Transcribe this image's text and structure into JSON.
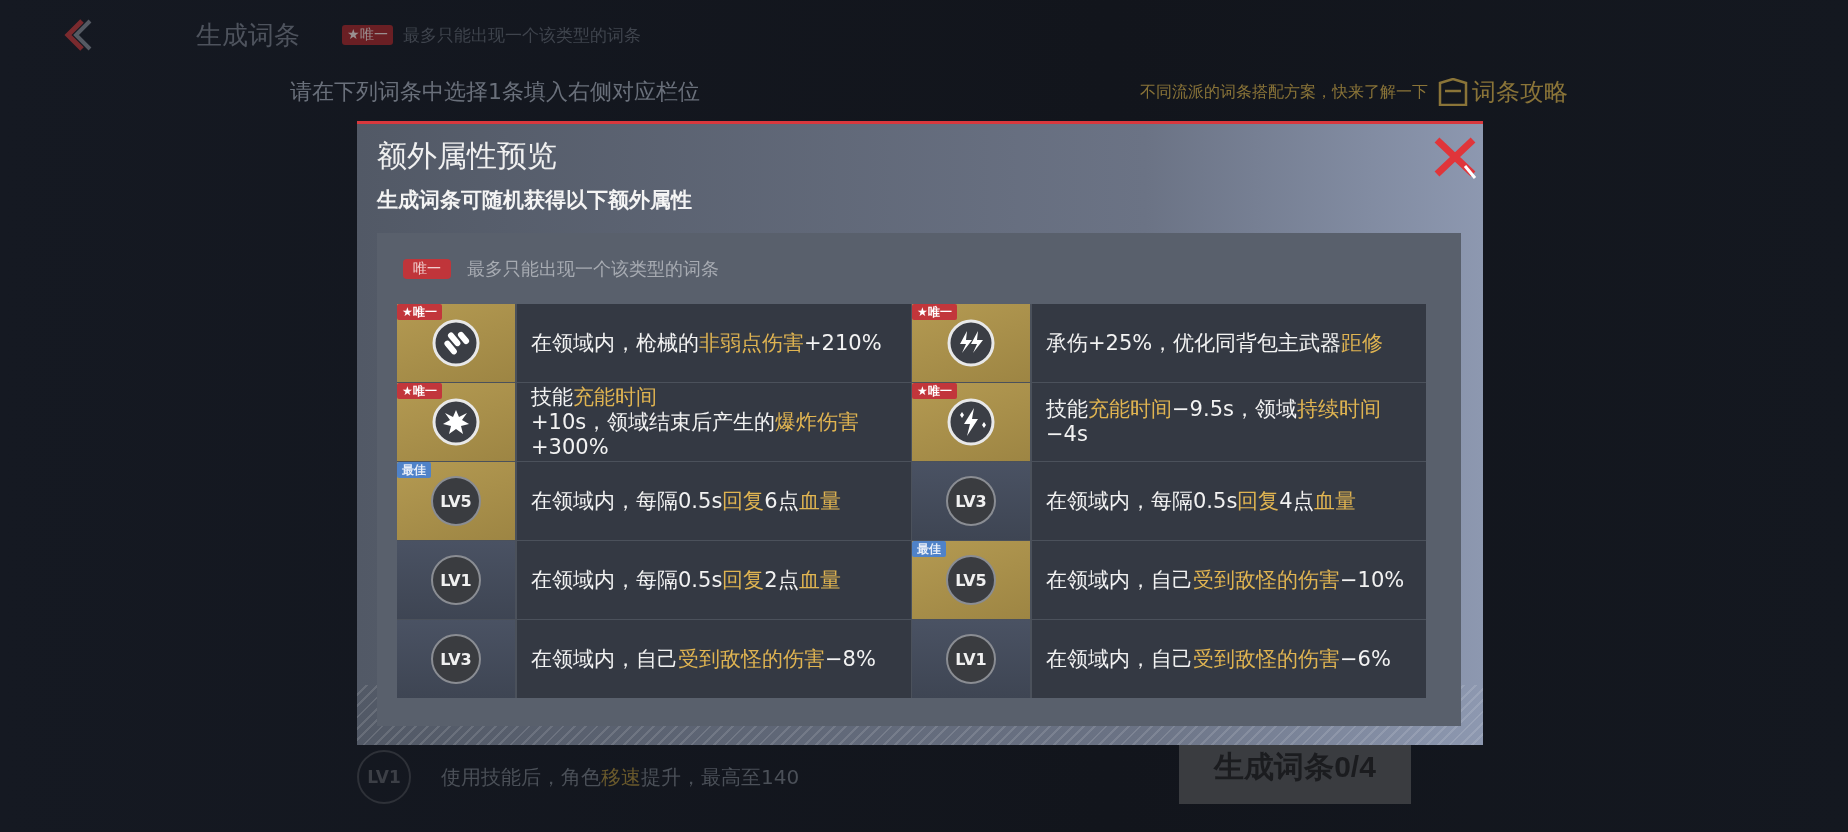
{
  "header": {
    "title": "生成词条",
    "badge": "★唯一",
    "note": "最多只能出现一个该类型的词条"
  },
  "instruction": "请在下列词条中选择1条填入右侧对应栏位",
  "guide": {
    "hint": "不同流派的词条搭配方案，快来了解一下",
    "link": "词条攻略"
  },
  "bottom_item": {
    "rank": "LV1",
    "text": [
      {
        "text": "使用技能后，角色",
        "highlight": false
      },
      {
        "text": "移速",
        "highlight": true
      },
      {
        "text": "提升，最高至140",
        "highlight": false
      }
    ]
  },
  "generate_button": "生成词条0/4",
  "dialog": {
    "title": "额外属性预览",
    "subtitle": "生成词条可随机获得以下额外属性",
    "legend": {
      "badge": "唯一",
      "text": "最多只能出现一个该类型的词条"
    },
    "entries": [
      {
        "kind": "icon",
        "highlighted": true,
        "tag": {
          "kind": "unique",
          "label": "★唯一"
        },
        "text": [
          {
            "text": "在领域内，枪械的",
            "highlight": false
          },
          {
            "text": "非弱点伤害",
            "highlight": true
          },
          {
            "text": "+210%",
            "highlight": false
          }
        ]
      },
      {
        "kind": "icon",
        "highlighted": true,
        "tag": {
          "kind": "unique",
          "label": "★唯一"
        },
        "text": [
          {
            "text": "承伤+25%，优化同背包主武器",
            "highlight": false
          },
          {
            "text": "距修",
            "highlight": true
          }
        ]
      },
      {
        "kind": "icon",
        "highlighted": true,
        "tag": {
          "kind": "unique",
          "label": "★唯一"
        },
        "text": [
          {
            "text": "技能",
            "highlight": false
          },
          {
            "text": "充能时间",
            "highlight": true
          },
          {
            "text": "+10s，领域结束后产生的",
            "highlight": false
          },
          {
            "text": "爆炸伤害",
            "highlight": true
          },
          {
            "text": "+300%",
            "highlight": false
          }
        ]
      },
      {
        "kind": "icon",
        "highlighted": true,
        "tag": {
          "kind": "unique",
          "label": "★唯一"
        },
        "text": [
          {
            "text": "技能",
            "highlight": false
          },
          {
            "text": "充能时间",
            "highlight": true
          },
          {
            "text": "−9.5s，领域",
            "highlight": false
          },
          {
            "text": "持续时间",
            "highlight": true
          },
          {
            "text": "−4s",
            "highlight": false
          }
        ]
      },
      {
        "kind": "level",
        "rank": "LV5",
        "highlighted": true,
        "tag": {
          "kind": "best",
          "label": "最佳"
        },
        "text": [
          {
            "text": "在领域内，每隔0.5s",
            "highlight": false
          },
          {
            "text": "回复",
            "highlight": true
          },
          {
            "text": "6点",
            "highlight": false
          },
          {
            "text": "血量",
            "highlight": true
          }
        ]
      },
      {
        "kind": "level",
        "rank": "LV3",
        "highlighted": false,
        "text": [
          {
            "text": "在领域内，每隔0.5s",
            "highlight": false
          },
          {
            "text": "回复",
            "highlight": true
          },
          {
            "text": "4点",
            "highlight": false
          },
          {
            "text": "血量",
            "highlight": true
          }
        ]
      },
      {
        "kind": "level",
        "rank": "LV1",
        "highlighted": false,
        "text": [
          {
            "text": "在领域内，每隔0.5s",
            "highlight": false
          },
          {
            "text": "回复",
            "highlight": true
          },
          {
            "text": "2点",
            "highlight": false
          },
          {
            "text": "血量",
            "highlight": true
          }
        ]
      },
      {
        "kind": "level",
        "rank": "LV5",
        "highlighted": true,
        "tag": {
          "kind": "best",
          "label": "最佳"
        },
        "text": [
          {
            "text": "在领域内，自己",
            "highlight": false
          },
          {
            "text": "受到敌怪的伤害",
            "highlight": true
          },
          {
            "text": "−10%",
            "highlight": false
          }
        ]
      },
      {
        "kind": "level",
        "rank": "LV3",
        "highlighted": false,
        "text": [
          {
            "text": "在领域内，自己",
            "highlight": false
          },
          {
            "text": "受到敌怪的伤害",
            "highlight": true
          },
          {
            "text": "−8%",
            "highlight": false
          }
        ]
      },
      {
        "kind": "level",
        "rank": "LV1",
        "highlighted": false,
        "text": [
          {
            "text": "在领域内，自己",
            "highlight": false
          },
          {
            "text": "受到敌怪的伤害",
            "highlight": true
          },
          {
            "text": "−6%",
            "highlight": false
          }
        ]
      }
    ]
  }
}
